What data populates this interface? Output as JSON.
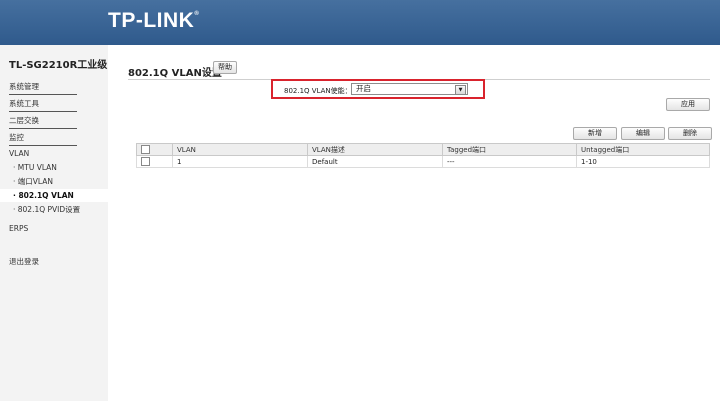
{
  "header": {
    "brand": "TP-LINK",
    "brand_mark": "®"
  },
  "sidebar": {
    "model": "TL-SG2210R工业级",
    "items": [
      {
        "label": "系统管理"
      },
      {
        "label": "系统工具"
      },
      {
        "label": "二层交换"
      },
      {
        "label": "监控"
      }
    ],
    "vlan_label": "VLAN",
    "sub_items": [
      {
        "label": "· MTU VLAN"
      },
      {
        "label": "· 端口VLAN"
      },
      {
        "label": "· 802.1Q VLAN"
      },
      {
        "label": "· 802.1Q PVID设置"
      }
    ],
    "erps_label": "ERPS",
    "logout_label": "退出登录"
  },
  "main": {
    "title": "802.1Q VLAN设置",
    "help_button": "帮助",
    "enable_label": "802.1Q VLAN使能：",
    "enable_value": "开启",
    "apply_button": "应用",
    "new_button": "新增",
    "edit_button": "编辑",
    "delete_button": "删除",
    "table": {
      "headers": [
        "VLAN",
        "VLAN描述",
        "Tagged端口",
        "Untagged端口"
      ],
      "rows": [
        {
          "vlan": "1",
          "desc": "Default",
          "tagged": "---",
          "untagged": "1-10"
        }
      ]
    }
  }
}
